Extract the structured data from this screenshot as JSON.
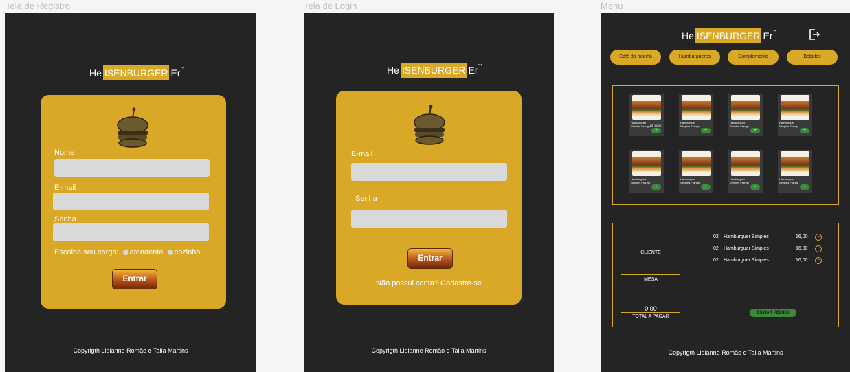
{
  "frames": {
    "registro": {
      "title": "Tela de Registro",
      "logo": {
        "left": "He",
        "mid": "ISENBURGER",
        "right": "Er",
        "tm": "™"
      },
      "fields": {
        "nome": "Nome",
        "email": "E-mail",
        "senha": "Senha"
      },
      "cargo_label": "Escolha seu cargo:",
      "options": {
        "atendente": "atendente",
        "cozinha": "cozinha"
      },
      "button": "Entrar",
      "copyright": "Copyrigth Lidianne Romão e Taila Martins"
    },
    "login": {
      "title": "Tela de Login",
      "logo": {
        "left": "He",
        "mid": "ISENBURGER",
        "right": "Er",
        "tm": "™"
      },
      "fields": {
        "email": "E-mail",
        "senha": "Senha"
      },
      "button": "Entrar",
      "signup_link": "Não possui conta? Cadastre-se",
      "copyright": "Copyrigth Lidianne Romão e Taila Martins"
    },
    "menu": {
      "title": "Menu",
      "logo": {
        "left": "He",
        "mid": "ISENBURGER",
        "right": "Er",
        "tm": "™"
      },
      "tabs": [
        "Café da manhã",
        "Hamburgueres",
        "Complemento",
        "Bebidas"
      ],
      "products": [
        {
          "name": "Hamburguer Simples Frango",
          "price": "R$ 16,00"
        },
        {
          "name": "Hamburguer Simples Frango",
          "price": ""
        },
        {
          "name": "Hamburguer Simples Frango",
          "price": ""
        },
        {
          "name": "Hamburguer Simples Frango",
          "price": ""
        },
        {
          "name": "Hamburguer Simples Frango",
          "price": ""
        },
        {
          "name": "Hamburguer Simples Frango",
          "price": ""
        },
        {
          "name": "Hamburguer Simples Frango",
          "price": ""
        },
        {
          "name": "Hamburguer Simples Frango",
          "price": ""
        }
      ],
      "add_label": "+",
      "order": {
        "cliente_label": "CLIENTE",
        "mesa_label": "MESA",
        "total_value": "0,00",
        "total_label": "TOTAL A PAGAR",
        "items": [
          {
            "qty": "02",
            "name": "Hamburguer Simples",
            "price": "16,00"
          },
          {
            "qty": "02",
            "name": "Hamburguer Simples",
            "price": "16,00"
          },
          {
            "qty": "02",
            "name": "Hamburguer Simples",
            "price": "16,00"
          }
        ],
        "remove_label": "−",
        "send_button": "ENVIAR PEDIDO"
      },
      "copyright": "Copyrigth Lidianne Romão e Taila Martins"
    }
  },
  "colors": {
    "background": "#242424",
    "accent": "#d9a826",
    "green": "#3a8a3a",
    "input": "#d9d9d9"
  }
}
